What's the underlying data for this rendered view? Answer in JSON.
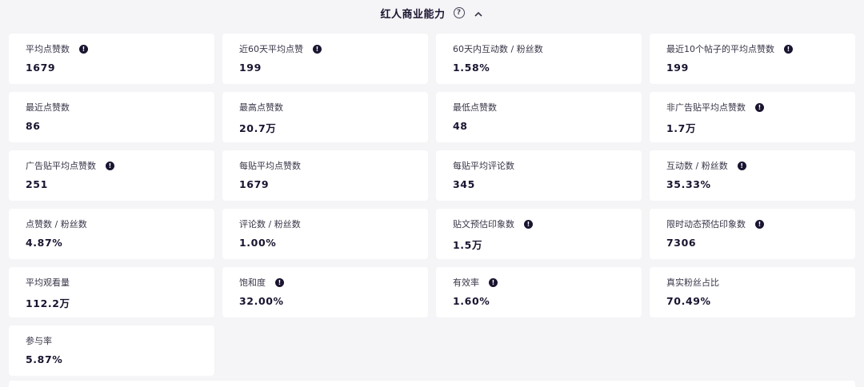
{
  "section": {
    "title": "红人商业能力"
  },
  "metrics": [
    {
      "label": "平均点赞数",
      "value": "1679",
      "info": true
    },
    {
      "label": "近60天平均点赞",
      "value": "199",
      "info": true
    },
    {
      "label": "60天内互动数 / 粉丝数",
      "value": "1.58%",
      "info": false
    },
    {
      "label": "最近10个帖子的平均点赞数",
      "value": "199",
      "info": true
    },
    {
      "label": "最近点赞数",
      "value": "86",
      "info": false
    },
    {
      "label": "最高点赞数",
      "value": "20.7万",
      "info": false
    },
    {
      "label": "最低点赞数",
      "value": "48",
      "info": false
    },
    {
      "label": "非广告贴平均点赞数",
      "value": "1.7万",
      "info": true
    },
    {
      "label": "广告贴平均点赞数",
      "value": "251",
      "info": true
    },
    {
      "label": "每贴平均点赞数",
      "value": "1679",
      "info": false
    },
    {
      "label": "每贴平均评论数",
      "value": "345",
      "info": false
    },
    {
      "label": "互动数 / 粉丝数",
      "value": "35.33%",
      "info": true
    },
    {
      "label": "点赞数 / 粉丝数",
      "value": "4.87%",
      "info": false
    },
    {
      "label": "评论数 / 粉丝数",
      "value": "1.00%",
      "info": false
    },
    {
      "label": "贴文预估印象数",
      "value": "1.5万",
      "info": true
    },
    {
      "label": "限时动态预估印象数",
      "value": "7306",
      "info": true
    },
    {
      "label": "平均观看量",
      "value": "112.2万",
      "info": false
    },
    {
      "label": "饱和度",
      "value": "32.00%",
      "info": true
    },
    {
      "label": "有效率",
      "value": "1.60%",
      "info": true
    },
    {
      "label": "真实粉丝占比",
      "value": "70.49%",
      "info": false
    },
    {
      "label": "参与率",
      "value": "5.87%",
      "info": false
    }
  ],
  "icons": {
    "help": "question-circle-icon",
    "collapse": "chevron-up-icon",
    "info": "info-circle-icon"
  }
}
